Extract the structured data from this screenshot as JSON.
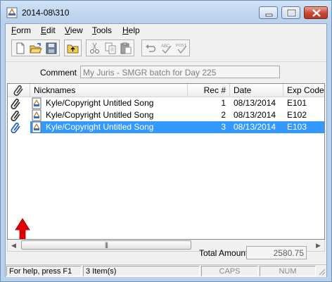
{
  "window": {
    "title": "2014-08\\310"
  },
  "menu": [
    {
      "label": "Form",
      "u": "F",
      "rest": "orm"
    },
    {
      "label": "Edit",
      "u": "E",
      "rest": "dit"
    },
    {
      "label": "View",
      "u": "V",
      "rest": "iew"
    },
    {
      "label": "Tools",
      "u": "T",
      "rest": "ools"
    },
    {
      "label": "Help",
      "u": "H",
      "rest": "elp"
    }
  ],
  "toolbar": {
    "buttons": [
      "new-icon",
      "open-folder-icon",
      "save-icon",
      "up-folder-icon",
      "cut-icon",
      "copy-icon",
      "paste-icon",
      "undo-icon",
      "spellcheck-icon",
      "post-icon"
    ]
  },
  "comment": {
    "label": "Comment",
    "value": "My Juris - SMGR batch for Day 225"
  },
  "grid": {
    "columns": [
      "Nicknames",
      "Rec #",
      "Date",
      "Exp Code"
    ],
    "rows": [
      {
        "nickname": "Kyle/Copyright Untitled Song",
        "rec": "1",
        "date": "08/13/2014",
        "code": "E101",
        "selected": false
      },
      {
        "nickname": "Kyle/Copyright Untitled Song",
        "rec": "2",
        "date": "08/13/2014",
        "code": "E102",
        "selected": false
      },
      {
        "nickname": "Kyle/Copyright Untitled Song",
        "rec": "3",
        "date": "08/13/2014",
        "code": "E103",
        "selected": true
      }
    ]
  },
  "total": {
    "label": "Total Amount",
    "value": "2580.75"
  },
  "status": {
    "help": "For help, press F1",
    "items": "3 Item(s)",
    "caps": "CAPS",
    "num": "NUM"
  },
  "colors": {
    "selection": "#3399ff",
    "arrow": "#e00000"
  }
}
